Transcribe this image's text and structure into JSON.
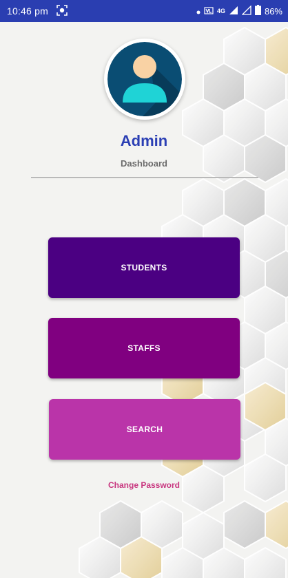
{
  "status_bar": {
    "time": "10:46 pm",
    "battery": "86%",
    "network": "4G",
    "icons": [
      "screen-record-icon",
      "dot-icon",
      "volte-icon",
      "signal-icon",
      "signal-empty-icon",
      "battery-icon"
    ]
  },
  "profile": {
    "title": "Admin",
    "subtitle": "Dashboard",
    "avatar_icon": "user-avatar-icon"
  },
  "menu": {
    "students_label": "STUDENTS",
    "staffs_label": "STAFFS",
    "search_label": "SEARCH"
  },
  "links": {
    "change_password": "Change Password"
  },
  "colors": {
    "status_bar": "#2a3eb1",
    "title": "#2b3fb4",
    "students": "#4b0082",
    "staffs": "#800080",
    "search": "#ba34a9",
    "link": "#c8367f"
  }
}
